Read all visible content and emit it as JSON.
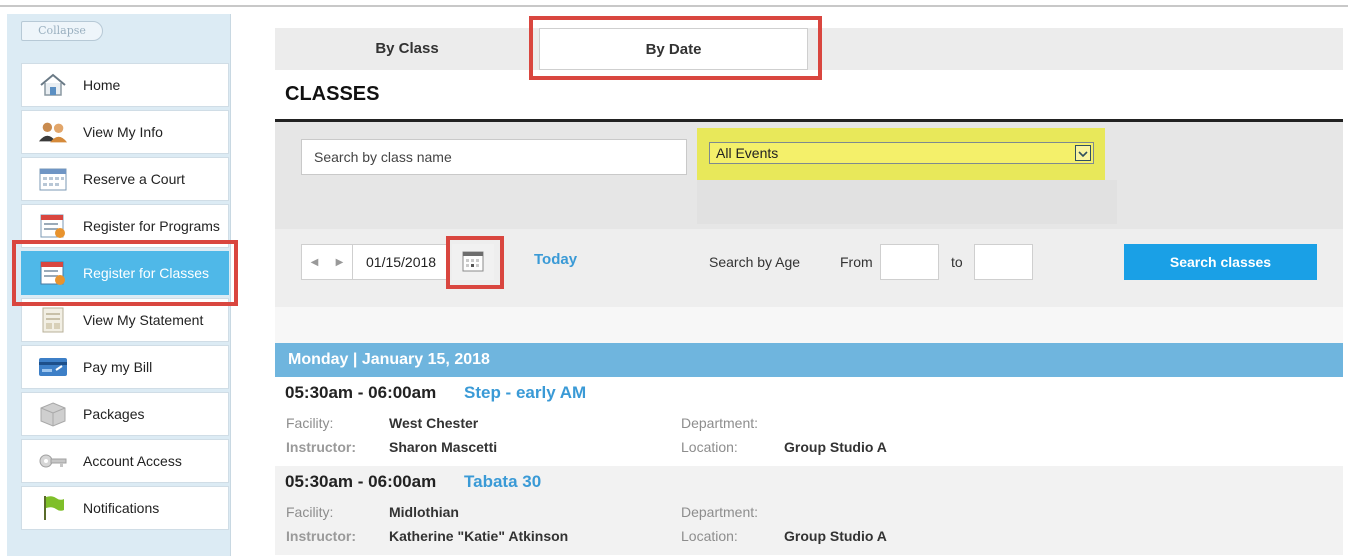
{
  "sidebar": {
    "collapse_label": "Collapse",
    "items": [
      {
        "label": "Home",
        "icon": "home-icon"
      },
      {
        "label": "View My Info",
        "icon": "users-icon"
      },
      {
        "label": "Reserve a Court",
        "icon": "calendar-icon"
      },
      {
        "label": "Register for Programs",
        "icon": "register-programs-icon"
      },
      {
        "label": "Register for Classes",
        "icon": "register-classes-icon"
      },
      {
        "label": "View My Statement",
        "icon": "statement-icon"
      },
      {
        "label": "Pay my Bill",
        "icon": "credit-card-icon"
      },
      {
        "label": "Packages",
        "icon": "package-icon"
      },
      {
        "label": "Account Access",
        "icon": "key-icon"
      },
      {
        "label": "Notifications",
        "icon": "flag-icon"
      }
    ]
  },
  "tabs": {
    "by_class": "By Class",
    "by_date": "By Date"
  },
  "title": "CLASSES",
  "filters": {
    "search_placeholder": "Search by class name",
    "events_selected": "All Events"
  },
  "datebar": {
    "date_value": "01/15/2018",
    "today_label": "Today",
    "age_label": "Search by Age",
    "from_label": "From",
    "to_label": "to",
    "search_button": "Search classes"
  },
  "schedule": {
    "day_header": "Monday | January 15, 2018",
    "field_labels": {
      "facility": "Facility:",
      "instructor": "Instructor:",
      "department": "Department:",
      "location": "Location:"
    },
    "classes": [
      {
        "time": "05:30am - 06:00am",
        "name": "Step - early AM",
        "facility": "West Chester",
        "instructor": "Sharon Mascetti",
        "location": "Group Studio A"
      },
      {
        "time": "05:30am - 06:00am",
        "name": "Tabata 30",
        "facility": "Midlothian",
        "instructor": "Katherine \"Katie\" Atkinson",
        "location": "Group Studio A"
      }
    ]
  },
  "colors": {
    "accent_blue": "#1aa0e6",
    "active_menu": "#4fb8e8",
    "highlight_red": "#d9463f",
    "highlight_yellow": "#e8e85a",
    "day_header": "#6fb5de"
  }
}
